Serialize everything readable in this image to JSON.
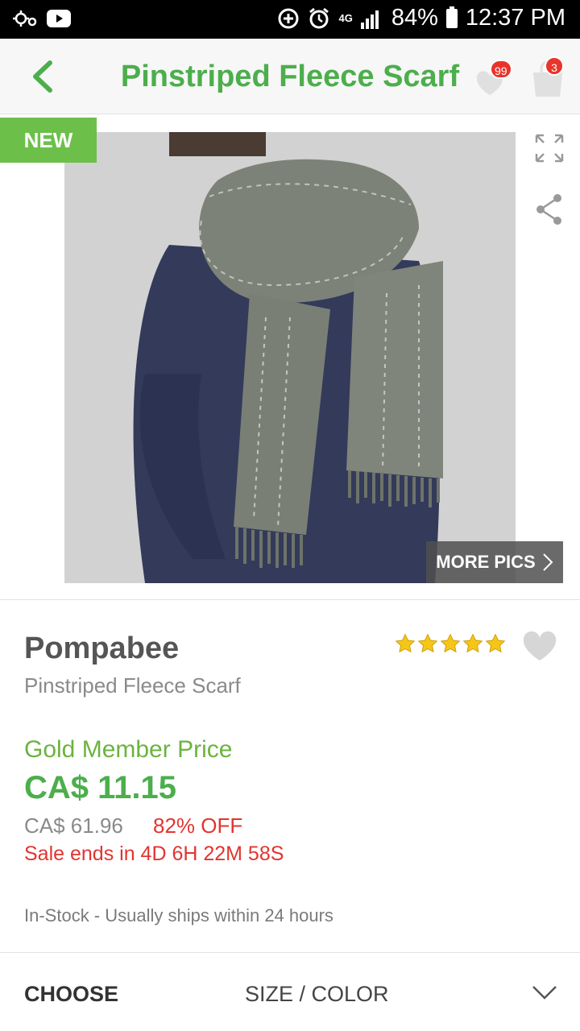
{
  "status_bar": {
    "battery": "84%",
    "time": "12:37 PM",
    "network": "4G"
  },
  "header": {
    "title": "Pinstriped Fleece Scarf",
    "wishlist_count": "99",
    "cart_count": "3"
  },
  "gallery": {
    "new_badge": "NEW",
    "more_pics_label": "MORE PICS"
  },
  "product": {
    "brand": "Pompabee",
    "name": "Pinstriped Fleece Scarf",
    "rating": 5,
    "member_price_label": "Gold Member Price",
    "price": "CA$ 11.15",
    "original_price": "CA$ 61.96",
    "discount": "82% OFF",
    "sale_ends": "Sale ends in 4D 6H 22M 58S",
    "stock_status": "In-Stock - Usually ships within 24 hours"
  },
  "options": {
    "choose_label": "CHOOSE",
    "size_color_label": "SIZE / COLOR"
  },
  "colors": {
    "brand_green": "#4cae4c",
    "badge_green": "#6cc04a",
    "sale_red": "#e3342f",
    "star_yellow": "#f5c518"
  }
}
